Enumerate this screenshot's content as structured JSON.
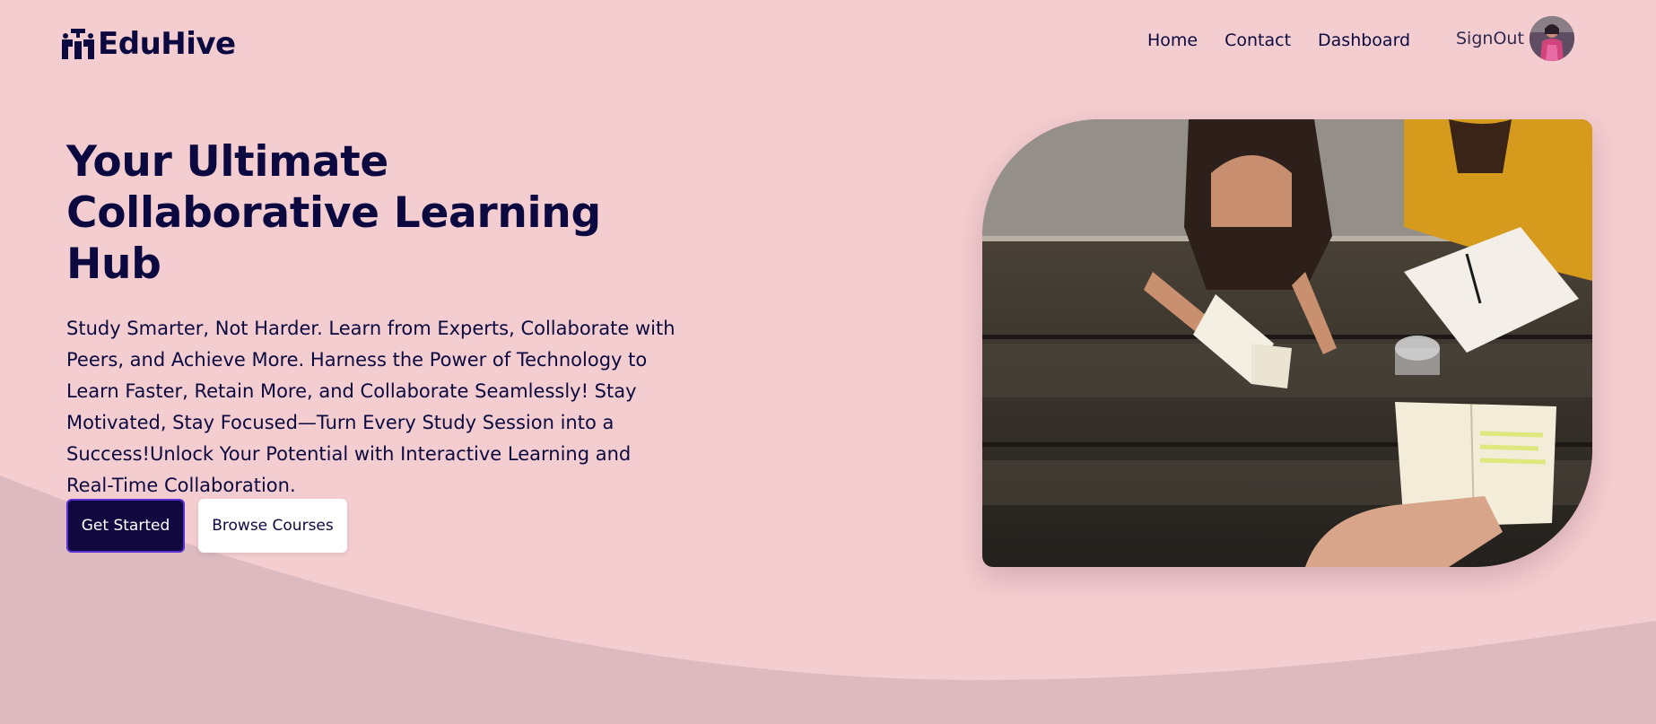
{
  "brand": {
    "name": "EduHive",
    "logo_icon": "graduation-hive-logo-icon",
    "text_color": "#0c0940"
  },
  "nav": {
    "items": [
      {
        "label": "Home"
      },
      {
        "label": "Contact"
      },
      {
        "label": "Dashboard"
      }
    ],
    "signout_label": "SignOut",
    "avatar_icon": "user-avatar"
  },
  "hero": {
    "title_line1": "Your Ultimate",
    "title_line2": "Collaborative Learning Hub",
    "description": "Study Smarter, Not Harder. Learn from Experts, Collaborate with Peers, and Achieve More. Harness the Power of Technology to Learn Faster, Retain More, and Collaborate Seamlessly! Stay Motivated, Stay Focused—Turn Every Study Session into a Success!Unlock Your Potential with Interactive Learning and Real-Time Collaboration.",
    "primary_button": "Get Started",
    "secondary_button": "Browse Courses",
    "image_icon": "students-studying-photo"
  },
  "colors": {
    "background": "#f3cdd0",
    "wave": "#dcbac0",
    "primary_button_bg": "#10083f",
    "primary_button_border": "#5a2fd6",
    "text": "#0c0940"
  }
}
